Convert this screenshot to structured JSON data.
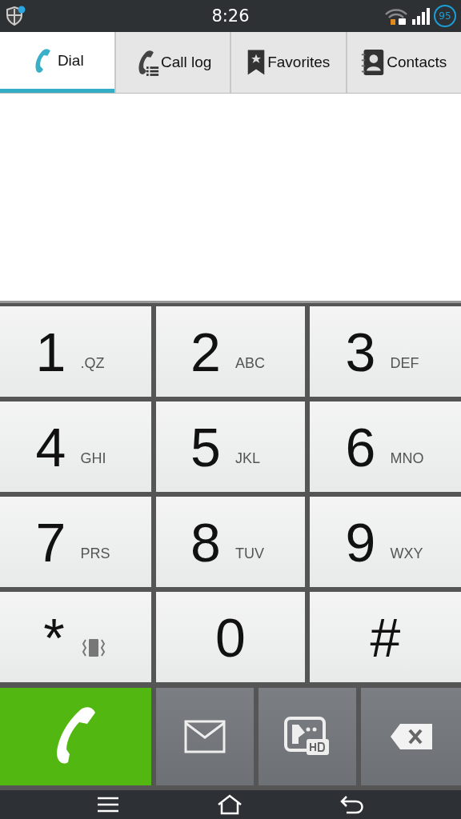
{
  "status_bar": {
    "time": "8:26",
    "battery": "95"
  },
  "tabs": [
    {
      "label": "Dial",
      "kind": "phone",
      "selected": true
    },
    {
      "label": "Call log",
      "kind": "log",
      "selected": false
    },
    {
      "label": "Favorites",
      "kind": "star",
      "selected": false
    },
    {
      "label": "Contacts",
      "kind": "contacts",
      "selected": false
    }
  ],
  "keys": [
    {
      "digit": "1",
      "letters": ".QZ",
      "kind": "letters"
    },
    {
      "digit": "2",
      "letters": "ABC",
      "kind": "letters"
    },
    {
      "digit": "3",
      "letters": "DEF",
      "kind": "letters"
    },
    {
      "digit": "4",
      "letters": "GHI",
      "kind": "letters"
    },
    {
      "digit": "5",
      "letters": "JKL",
      "kind": "letters"
    },
    {
      "digit": "6",
      "letters": "MNO",
      "kind": "letters"
    },
    {
      "digit": "7",
      "letters": "PRS",
      "kind": "letters"
    },
    {
      "digit": "8",
      "letters": "TUV",
      "kind": "letters"
    },
    {
      "digit": "9",
      "letters": "WXY",
      "kind": "letters"
    },
    {
      "digit": "*",
      "kind": "vibrate"
    },
    {
      "digit": "0",
      "kind": "bare"
    },
    {
      "digit": "#",
      "kind": "bare"
    }
  ],
  "actions": [
    {
      "kind": "call"
    },
    {
      "kind": "message"
    },
    {
      "kind": "video"
    },
    {
      "kind": "delete"
    }
  ]
}
